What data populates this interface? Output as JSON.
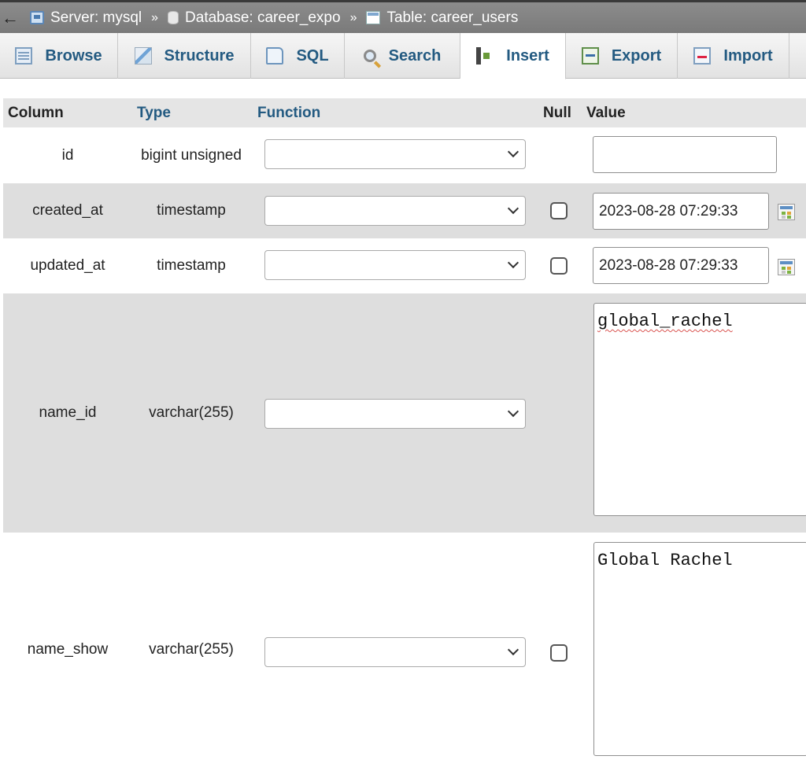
{
  "nav": {
    "back_glyph": "←"
  },
  "breadcrumb": {
    "separator": "»",
    "server": "Server: mysql",
    "database": "Database: career_expo",
    "table": "Table: career_users"
  },
  "tabs": [
    {
      "label": "Browse",
      "icon": "browse-icon"
    },
    {
      "label": "Structure",
      "icon": "structure-icon"
    },
    {
      "label": "SQL",
      "icon": "sql-icon"
    },
    {
      "label": "Search",
      "icon": "search-icon"
    },
    {
      "label": "Insert",
      "icon": "insert-icon",
      "active": true
    },
    {
      "label": "Export",
      "icon": "export-icon"
    },
    {
      "label": "Import",
      "icon": "import-icon"
    }
  ],
  "headers": {
    "column": "Column",
    "type": "Type",
    "function": "Function",
    "null": "Null",
    "value": "Value"
  },
  "rows": [
    {
      "column": "id",
      "type": "bigint unsigned",
      "function": "",
      "has_null": false,
      "value": ""
    },
    {
      "column": "created_at",
      "type": "timestamp",
      "function": "",
      "has_null": true,
      "value": "2023-08-28 07:29:33"
    },
    {
      "column": "updated_at",
      "type": "timestamp",
      "function": "",
      "has_null": true,
      "value": "2023-08-28 07:29:33"
    },
    {
      "column": "name_id",
      "type": "varchar(255)",
      "function": "",
      "has_null": false,
      "value": "global_rachel"
    },
    {
      "column": "name_show",
      "type": "varchar(255)",
      "function": "",
      "has_null": true,
      "value": "Global Rachel"
    }
  ],
  "colors": {
    "link_blue": "#235a81",
    "header_bg": "#e5e5e5",
    "shaded_row": "#dedede",
    "topbar": "#808080"
  }
}
